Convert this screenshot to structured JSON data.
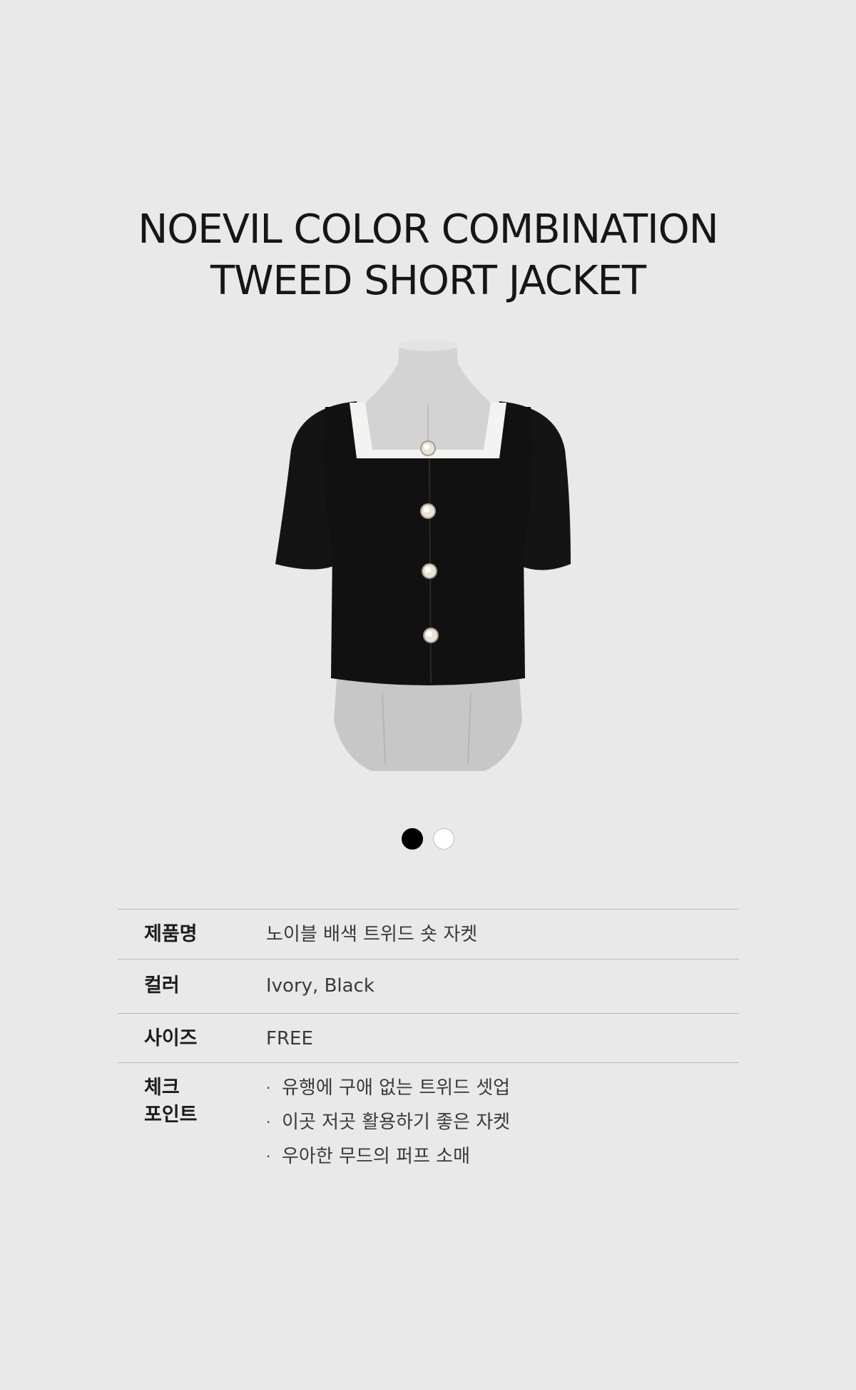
{
  "title": {
    "line1": "NOEVIL COLOR COMBINATION",
    "line2": "TWEED SHORT JACKET"
  },
  "product_image": {
    "description_icon": "jacket-on-mannequin",
    "colors": {
      "jacket": "#111111",
      "collar": "#f4f4f2",
      "mannequin": "#cfcfcf"
    }
  },
  "swatches": [
    {
      "color": "#000000"
    },
    {
      "color": "#ffffff"
    }
  ],
  "specs": {
    "name": {
      "label": "제품명",
      "value": "노이블 배색 트위드 숏 자켓"
    },
    "color": {
      "label": "컬러",
      "value": "Ivory, Black"
    },
    "size": {
      "label": "사이즈",
      "value": "FREE"
    },
    "check": {
      "label_line1": "체크",
      "label_line2": "포인트",
      "bullet": "·",
      "points": [
        "유행에 구애 없는 트위드 셋업",
        "이곳 저곳 활용하기 좋은 자켓",
        "우아한 무드의 퍼프 소매"
      ]
    }
  }
}
